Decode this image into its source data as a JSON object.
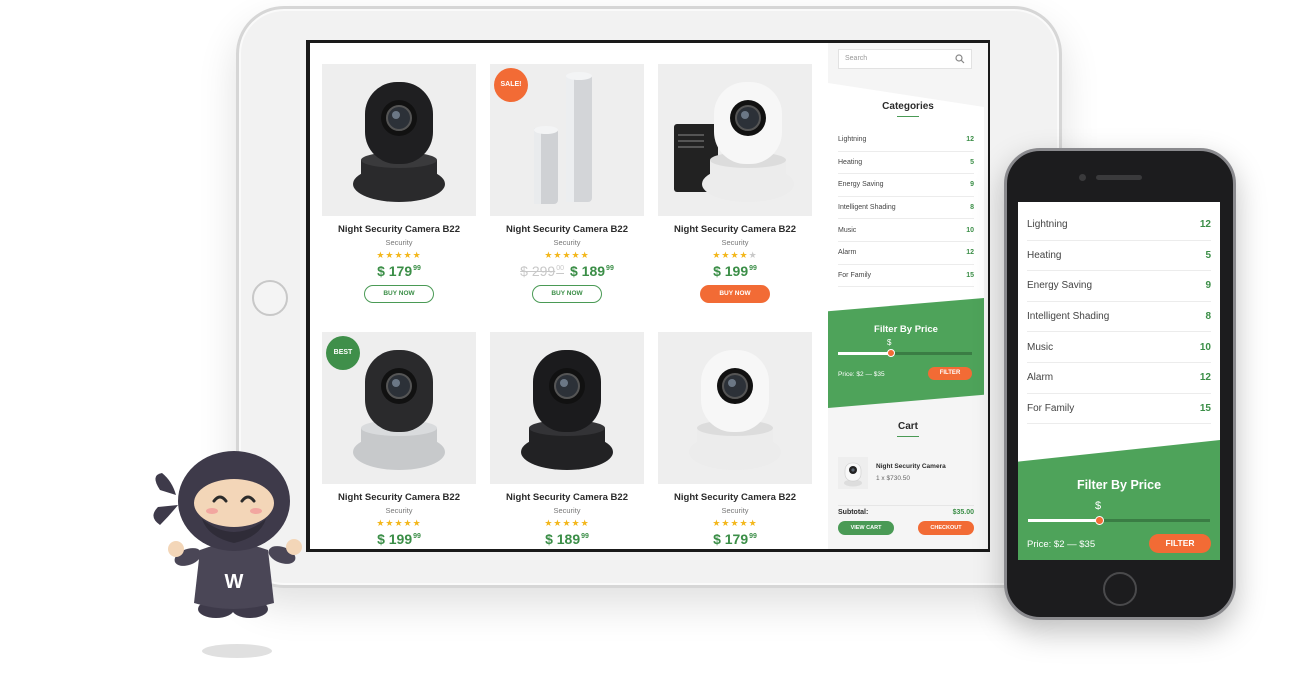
{
  "products": [
    {
      "name": "Night Security Camera B22",
      "category": "Security",
      "rating": 5,
      "old_price": "",
      "price": "$ 179",
      "cents": "99",
      "button": "BUY NOW",
      "button_style": "outline",
      "badge": "",
      "camera": "black"
    },
    {
      "name": "Night Security Camera B22",
      "category": "Security",
      "rating": 5,
      "old_price": "$ 299",
      "old_cents": "00",
      "price": "$ 189",
      "cents": "99",
      "button": "BUY NOW",
      "button_style": "outline",
      "badge": "SALE!",
      "camera": "station"
    },
    {
      "name": "Night Security Camera B22",
      "category": "Security",
      "rating": 4,
      "old_price": "",
      "price": "$ 199",
      "cents": "99",
      "button": "BUY NOW",
      "button_style": "filled",
      "badge": "",
      "camera": "white-sd"
    },
    {
      "name": "Night Security Camera B22",
      "category": "Security",
      "rating": 5,
      "old_price": "",
      "price": "$ 199",
      "cents": "99",
      "button": "",
      "button_style": "",
      "badge": "BEST",
      "camera": "silver"
    },
    {
      "name": "Night Security Camera B22",
      "category": "Security",
      "rating": 5,
      "old_price": "",
      "price": "$ 189",
      "cents": "99",
      "button": "",
      "button_style": "",
      "badge": "",
      "camera": "black-wide"
    },
    {
      "name": "Night Security Camera B22",
      "category": "Security",
      "rating": 5,
      "old_price": "",
      "price": "$ 179",
      "cents": "99",
      "button": "",
      "button_style": "",
      "badge": "",
      "camera": "white"
    }
  ],
  "sidebar": {
    "search_placeholder": "Search",
    "categories_title": "Categories",
    "categories": [
      {
        "label": "Lightning",
        "count": "12"
      },
      {
        "label": "Heating",
        "count": "5"
      },
      {
        "label": "Energy Saving",
        "count": "9"
      },
      {
        "label": "Intelligent Shading",
        "count": "8"
      },
      {
        "label": "Music",
        "count": "10"
      },
      {
        "label": "Alarm",
        "count": "12"
      },
      {
        "label": "For Family",
        "count": "15"
      }
    ],
    "filter": {
      "title": "Filter By Price",
      "currency": "$",
      "range": "Price: $2 — $35",
      "button": "FILTER"
    },
    "cart": {
      "title": "Cart",
      "item_name": "Night Security Camera",
      "item_qty": "1 x $730.50",
      "subtotal_label": "Subtotal:",
      "subtotal_value": "$35.00",
      "view_cart": "VIEW CART",
      "checkout": "CHECKOUT"
    }
  },
  "phone": {
    "categories": [
      {
        "label": "Lightning",
        "count": "12"
      },
      {
        "label": "Heating",
        "count": "5"
      },
      {
        "label": "Energy Saving",
        "count": "9"
      },
      {
        "label": "Intelligent Shading",
        "count": "8"
      },
      {
        "label": "Music",
        "count": "10"
      },
      {
        "label": "Alarm",
        "count": "12"
      },
      {
        "label": "For Family",
        "count": "15"
      }
    ],
    "filter": {
      "title": "Filter By Price",
      "currency": "$",
      "range": "Price: $2 — $35",
      "button": "FILTER"
    }
  },
  "mascot": {
    "letter": "W"
  },
  "colors": {
    "green": "#4ea35a",
    "orange": "#f26b35",
    "star": "#f3b71c"
  }
}
